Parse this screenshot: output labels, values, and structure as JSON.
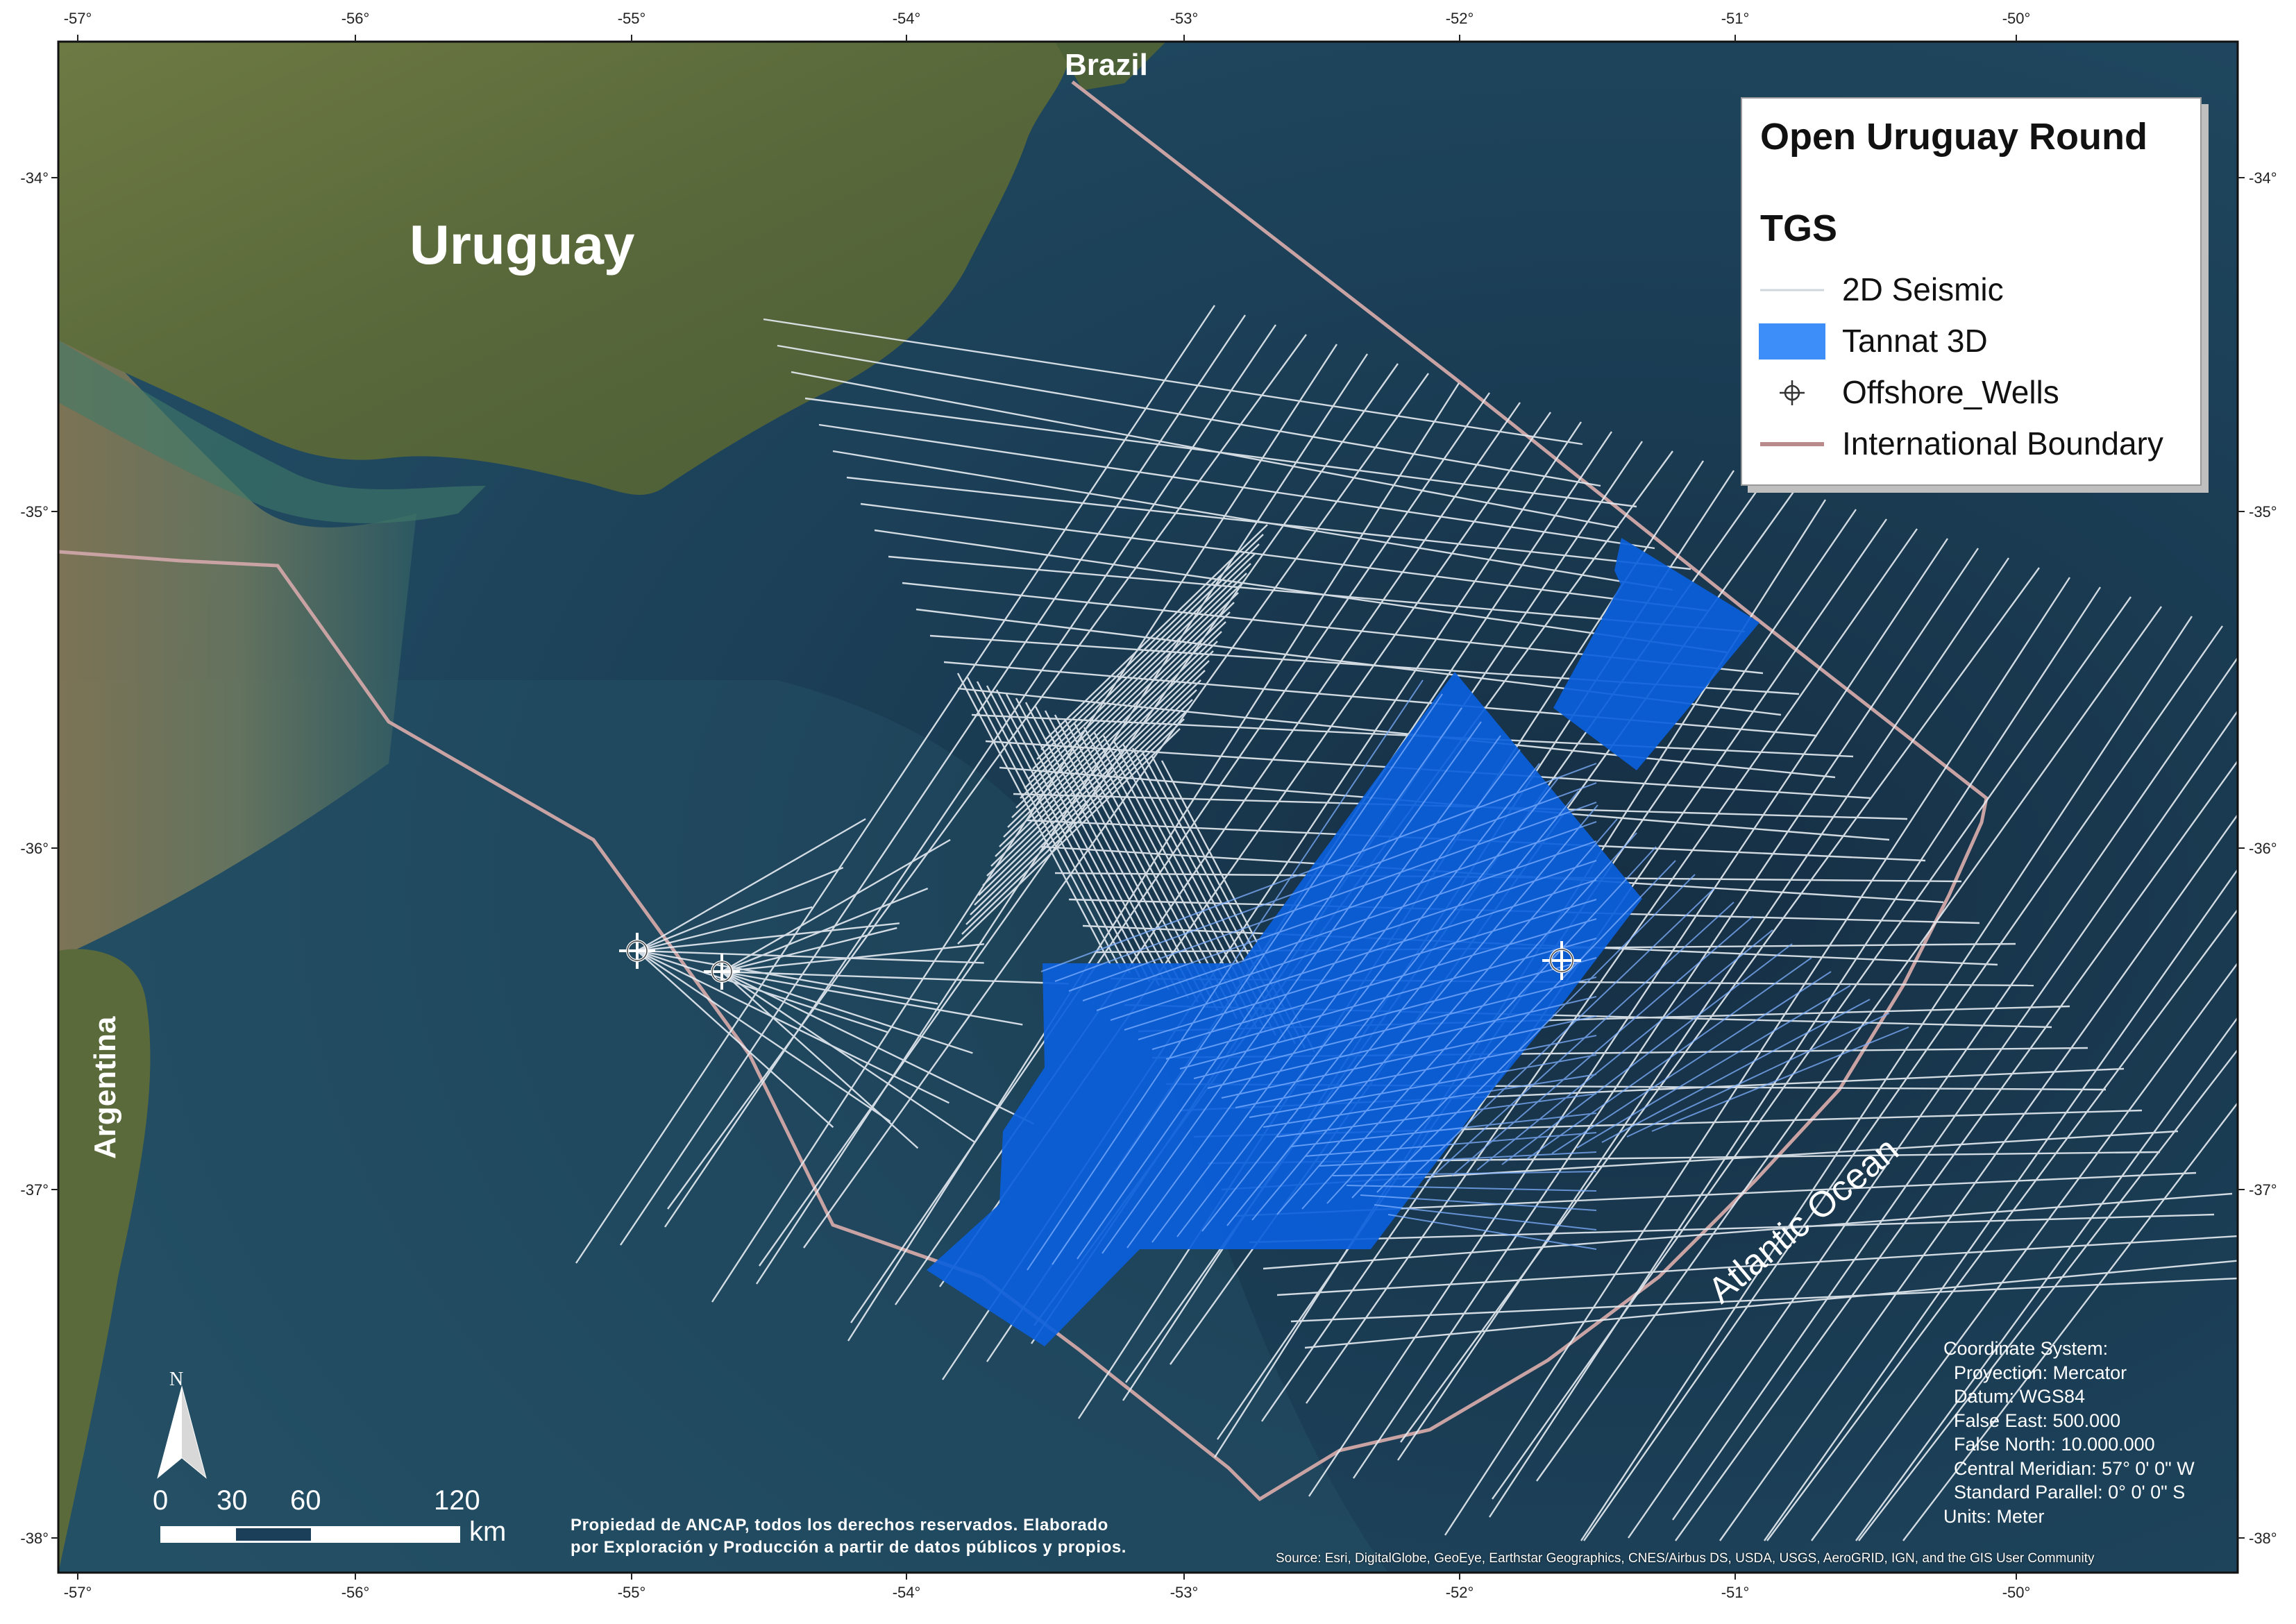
{
  "axes": {
    "lon_labels": [
      "-57°",
      "-56°",
      "-55°",
      "-54°",
      "-53°",
      "-52°",
      "-51°",
      "-50°"
    ],
    "lat_labels": [
      "-34°",
      "-35°",
      "-36°",
      "-37°",
      "-38°"
    ]
  },
  "places": {
    "uruguay": "Uruguay",
    "brazil": "Brazil",
    "argentina": "Argentina",
    "atlantic": "Atlantic Ocean"
  },
  "legend": {
    "title": "Open Uruguay Round",
    "subtitle": "TGS",
    "items": [
      {
        "label": "2D Seismic",
        "symbol": "line-light-gray"
      },
      {
        "label": "Tannat 3D",
        "symbol": "blue-fill"
      },
      {
        "label": "Offshore_Wells",
        "symbol": "crosshair-icon"
      },
      {
        "label": "International Boundary",
        "symbol": "line-rose"
      }
    ]
  },
  "colors": {
    "tannat_fill": "#0b5fdc",
    "legend_tannat": "#3d8ef8",
    "boundary": "#c9a3a3",
    "seismic": "#e6ecf2",
    "ocean": "#1b3f58",
    "land": "#5d6b3a"
  },
  "scale_bar": {
    "ticks": [
      "0",
      "30",
      "60",
      "120"
    ],
    "unit": "km"
  },
  "north_arrow": {
    "letter": "N"
  },
  "credit": {
    "line1": "Propiedad de ANCAP, todos los derechos reservados. Elaborado",
    "line2": "por Exploración y Producción a partir de datos públicos y propios."
  },
  "coordinate_system": {
    "lines": [
      "Coordinate System:",
      "  Proyection: Mercator",
      "  Datum: WGS84",
      "  False East: 500.000",
      "  False North: 10.000.000",
      "  Central Meridian: 57° 0' 0\" W",
      "  Standard Parallel: 0° 0' 0\" S",
      "Units: Meter"
    ]
  },
  "source": "Source: Esri, DigitalGlobe, GeoEye, Earthstar Geographics, CNES/Airbus DS, USDA, USGS, AeroGRID, IGN, and the GIS User Community"
}
